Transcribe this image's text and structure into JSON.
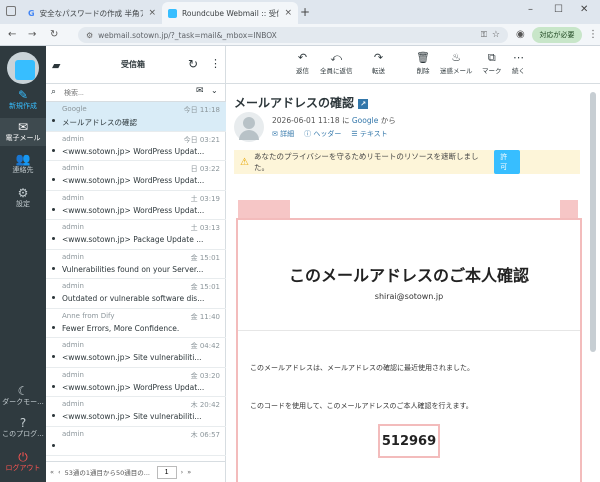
{
  "browser": {
    "tabs": [
      {
        "title": "安全なパスワードの作成 半角アルファ"
      },
      {
        "title": "Roundcube Webmail :: 受信箱"
      }
    ],
    "url": "webmail.sotown.jp/?_task=mail&_mbox=INBOX",
    "action_button": "対応が必要"
  },
  "nav": {
    "compose": "新規作成",
    "mail": "電子メール",
    "contacts": "連絡先",
    "settings": "設定",
    "dark": "ダークモー...",
    "about": "このプログ...",
    "logout": "ログアウト"
  },
  "list": {
    "title": "受信箱",
    "search_placeholder": "検索...",
    "messages": [
      {
        "from": "Google",
        "date": "今日 11:18",
        "subject": "メールアドレスの確認"
      },
      {
        "from": "admin",
        "date": "今日 03:21",
        "subject": "<www.sotown.jp> WordPress Updat..."
      },
      {
        "from": "admin",
        "date": "日 03:22",
        "subject": "<www.sotown.jp> WordPress Updat..."
      },
      {
        "from": "admin",
        "date": "土 03:19",
        "subject": "<www.sotown.jp> WordPress Updat..."
      },
      {
        "from": "admin",
        "date": "土 03:13",
        "subject": "<www.sotown.jp> Package Update ..."
      },
      {
        "from": "admin",
        "date": "金 15:01",
        "subject": "Vulnerabilities found on your Server..."
      },
      {
        "from": "admin",
        "date": "金 15:01",
        "subject": "Outdated or vulnerable software dis..."
      },
      {
        "from": "Anne from Dify",
        "date": "金 11:40",
        "subject": "Fewer Errors, More Confidence."
      },
      {
        "from": "admin",
        "date": "金 04:42",
        "subject": "<www.sotown.jp> Site vulnerabiliti..."
      },
      {
        "from": "admin",
        "date": "金 03:20",
        "subject": "<www.sotown.jp> WordPress Updat..."
      },
      {
        "from": "admin",
        "date": "木 20:42",
        "subject": "<www.sotown.jp> Site vulnerabiliti..."
      },
      {
        "from": "admin",
        "date": "木 06:57",
        "subject": ""
      }
    ],
    "pager_text": "53通の1通目から50通目の...",
    "page": "1"
  },
  "toolbar": {
    "reply": "返信",
    "reply_all": "全員に返信",
    "forward": "転送",
    "delete": "削除",
    "spam": "迷惑メール",
    "mark": "マーク",
    "more": "続く"
  },
  "message": {
    "subject": "メールアドレスの確認",
    "date": "2026-06-01 11:18",
    "from_prefix": "に",
    "from_name": "Google",
    "from_suffix": "から",
    "details": "詳細",
    "headers": "ヘッダー",
    "text": "テキスト",
    "privacy": "あなたのプライバシーを守るためリモートのリソースを遮断しました。",
    "allow": "許可",
    "body_title": "このメールアドレスのご本人確認",
    "body_email": "shirai@sotown.jp",
    "body_line1": "このメールアドレスは、メールアドレスの確認に最近使用されました。",
    "body_line2": "このコードを使用して、このメールアドレスのご本人確認を行えます。",
    "code": "512969"
  }
}
